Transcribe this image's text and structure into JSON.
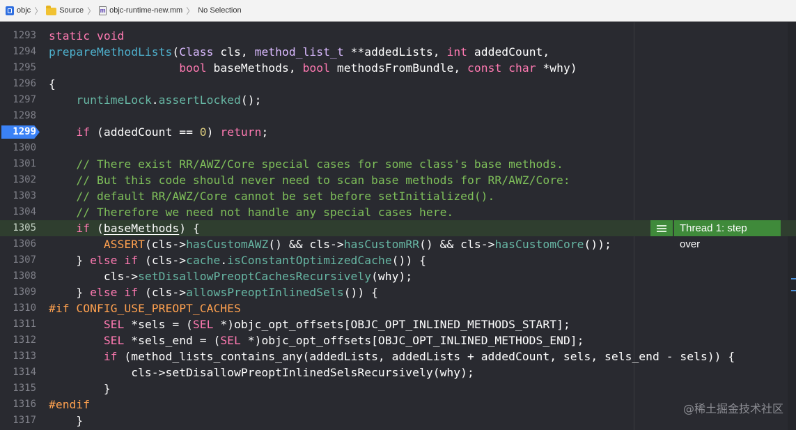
{
  "jumpbar": {
    "items": [
      {
        "label": "objc",
        "icon": "project-icon"
      },
      {
        "label": "Source",
        "icon": "folder-icon"
      },
      {
        "label": "objc-runtime-new.mm",
        "icon": "file-icon",
        "icon_glyph": "m"
      },
      {
        "label": "No Selection",
        "icon": ""
      }
    ],
    "separator": "〉"
  },
  "editor": {
    "partial_top_line": "1292",
    "breakpoint_line": "1299",
    "current_line": "1305",
    "lines": [
      {
        "num": "1293",
        "code": "static void"
      },
      {
        "num": "1294",
        "code": "prepareMethodLists(Class cls, method_list_t **addedLists, int addedCount,"
      },
      {
        "num": "1295",
        "code": "                   bool baseMethods, bool methodsFromBundle, const char *why)"
      },
      {
        "num": "1296",
        "code": "{"
      },
      {
        "num": "1297",
        "code": "    runtimeLock.assertLocked();"
      },
      {
        "num": "1298",
        "code": ""
      },
      {
        "num": "1299",
        "code": "    if (addedCount == 0) return;"
      },
      {
        "num": "1300",
        "code": ""
      },
      {
        "num": "1301",
        "code": "    // There exist RR/AWZ/Core special cases for some class's base methods."
      },
      {
        "num": "1302",
        "code": "    // But this code should never need to scan base methods for RR/AWZ/Core:"
      },
      {
        "num": "1303",
        "code": "    // default RR/AWZ/Core cannot be set before setInitialized()."
      },
      {
        "num": "1304",
        "code": "    // Therefore we need not handle any special cases here."
      },
      {
        "num": "1305",
        "code": "    if (baseMethods) {"
      },
      {
        "num": "1306",
        "code": "        ASSERT(cls->hasCustomAWZ() && cls->hasCustomRR() && cls->hasCustomCore());"
      },
      {
        "num": "1307",
        "code": "    } else if (cls->cache.isConstantOptimizedCache()) {"
      },
      {
        "num": "1308",
        "code": "        cls->setDisallowPreoptCachesRecursively(why);"
      },
      {
        "num": "1309",
        "code": "    } else if (cls->allowsPreoptInlinedSels()) {"
      },
      {
        "num": "1310",
        "code": "#if CONFIG_USE_PREOPT_CACHES"
      },
      {
        "num": "1311",
        "code": "        SEL *sels = (SEL *)objc_opt_offsets[OBJC_OPT_INLINED_METHODS_START];"
      },
      {
        "num": "1312",
        "code": "        SEL *sels_end = (SEL *)objc_opt_offsets[OBJC_OPT_INLINED_METHODS_END];"
      },
      {
        "num": "1313",
        "code": "        if (method_lists_contains_any(addedLists, addedLists + addedCount, sels, sels_end - sels)) {"
      },
      {
        "num": "1314",
        "code": "            cls->setDisallowPreoptInlinedSelsRecursively(why);"
      },
      {
        "num": "1315",
        "code": "        }"
      },
      {
        "num": "1316",
        "code": "#endif"
      },
      {
        "num": "1317",
        "code": "    }"
      }
    ]
  },
  "debugger": {
    "thread_badge_label": "Thread 1: step over",
    "thread_badge_icon": "list-icon",
    "badge_color": "#3f8a3a",
    "current_line_bg": "#2f3e2f",
    "breakpoint_color": "#3b82f6"
  },
  "watermark": "@稀土掘金技术社区"
}
